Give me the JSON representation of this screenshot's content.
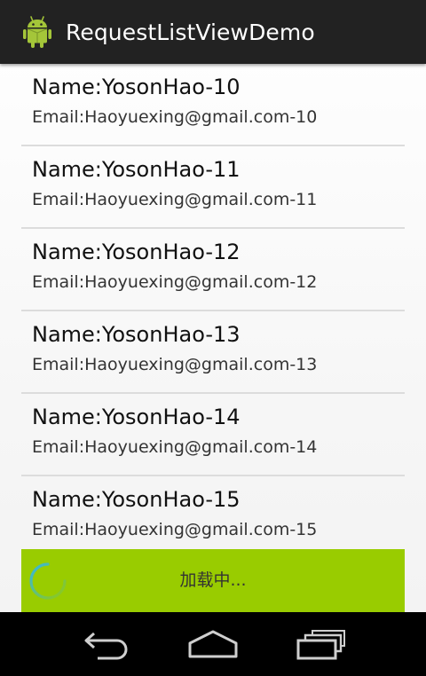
{
  "app": {
    "title": "RequestListViewDemo",
    "icon": "android-robot-icon"
  },
  "list": {
    "items": [
      {
        "name": "Name:YosonHao-10",
        "email": "Email:Haoyuexing@gmail.com-10"
      },
      {
        "name": "Name:YosonHao-11",
        "email": "Email:Haoyuexing@gmail.com-11"
      },
      {
        "name": "Name:YosonHao-12",
        "email": "Email:Haoyuexing@gmail.com-12"
      },
      {
        "name": "Name:YosonHao-13",
        "email": "Email:Haoyuexing@gmail.com-13"
      },
      {
        "name": "Name:YosonHao-14",
        "email": "Email:Haoyuexing@gmail.com-14"
      },
      {
        "name": "Name:YosonHao-15",
        "email": "Email:Haoyuexing@gmail.com-15"
      }
    ]
  },
  "footer": {
    "loading_text": "加载中...",
    "background": "#99cc00"
  },
  "nav": {
    "buttons": [
      "back-icon",
      "home-icon",
      "recent-apps-icon"
    ]
  },
  "colors": {
    "action_bar": "#222222",
    "accent": "#99cc00",
    "spinner": "#33b5e5"
  }
}
